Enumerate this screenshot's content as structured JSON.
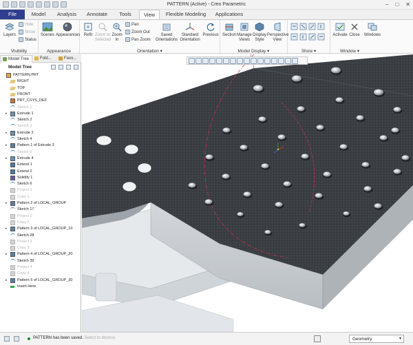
{
  "window": {
    "title": "PATTERN (Active) - Creo Parametric"
  },
  "tabs": [
    "File",
    "Model",
    "Analysis",
    "Annotate",
    "Tools",
    "View",
    "Flexible Modeling",
    "Applications"
  ],
  "ribbon": {
    "visibility": {
      "layers": "Layers",
      "hide": "Hide",
      "show": "Show",
      "status": "Status",
      "label": "Visibility"
    },
    "appearance": {
      "scenes": "Scenes",
      "appearances": "Appearances",
      "label": "Appearance"
    },
    "orientation": {
      "refit": "Refit",
      "zoom_selected_1": "Zoom to",
      "zoom_selected_2": "Selected",
      "zoom_in_1": "Zoom",
      "zoom_in_2": "In",
      "pan": "Pan",
      "zoom_out": "Zoom Out",
      "pan_zoom": "Pan Zoom",
      "saved_1": "Saved",
      "saved_2": "Orientations",
      "standard_1": "Standard",
      "standard_2": "Orientation",
      "previous": "Previous",
      "label": "Orientation"
    },
    "model_display": {
      "section": "Section",
      "manage_views_1": "Manage",
      "manage_views_2": "Views",
      "display_style_1": "Display",
      "display_style_2": "Style",
      "perspective_1": "Perspective",
      "perspective_2": "View",
      "label": "Model Display"
    },
    "show": {
      "label": "Show"
    },
    "window": {
      "activate": "Activate",
      "close": "Close",
      "windows": "Windows",
      "label": "Window"
    }
  },
  "panel": {
    "tabs": [
      "Model Tree",
      "Fold...",
      "Favo..."
    ],
    "tree_label": "Model Tree"
  },
  "tree": [
    {
      "label": "PATTERN.PRT",
      "dim": false,
      "expander": "",
      "icon": "part"
    },
    {
      "label": "RIGHT",
      "dim": false,
      "expander": "",
      "icon": "plane"
    },
    {
      "label": "TOP",
      "dim": false,
      "expander": "",
      "icon": "plane"
    },
    {
      "label": "FRONT",
      "dim": false,
      "expander": "",
      "icon": "plane"
    },
    {
      "label": "PRT_CSYS_DEF",
      "dim": false,
      "expander": "",
      "icon": "csys"
    },
    {
      "label": "Sketch 1",
      "dim": true,
      "expander": "",
      "icon": "sketch"
    },
    {
      "label": "Extrude 1",
      "dim": false,
      "expander": "▸",
      "icon": "extrude"
    },
    {
      "label": "Sketch 2",
      "dim": false,
      "expander": "",
      "icon": "sketch"
    },
    {
      "label": "Sketch 3",
      "dim": true,
      "expander": "",
      "icon": "sketch"
    },
    {
      "label": "Extrude 2",
      "dim": false,
      "expander": "▸",
      "icon": "extrude"
    },
    {
      "label": "Sketch 4",
      "dim": false,
      "expander": "",
      "icon": "sketch"
    },
    {
      "label": "Pattern 1 of Extrude 3",
      "dim": false,
      "expander": "▸",
      "icon": "pattern"
    },
    {
      "label": "Sketch 5",
      "dim": true,
      "expander": "",
      "icon": "sketch"
    },
    {
      "label": "Extrude 4",
      "dim": false,
      "expander": "▸",
      "icon": "extrude"
    },
    {
      "label": "Extend 1",
      "dim": false,
      "expander": "",
      "icon": "extend"
    },
    {
      "label": "Extend 2",
      "dim": false,
      "expander": "",
      "icon": "extend"
    },
    {
      "label": "Solidify 1",
      "dim": false,
      "expander": "",
      "icon": "solidify"
    },
    {
      "label": "Sketch 6",
      "dim": false,
      "expander": "",
      "icon": "sketch"
    },
    {
      "label": "Project 1",
      "dim": true,
      "expander": "",
      "icon": "project"
    },
    {
      "label": "Copy 1",
      "dim": true,
      "expander": "",
      "icon": "copy"
    },
    {
      "label": "Pattern 2 of LOCAL_GROUP",
      "dim": false,
      "expander": "▸",
      "icon": "pattern"
    },
    {
      "label": "Sketch 17",
      "dim": false,
      "expander": "",
      "icon": "sketch"
    },
    {
      "label": "Project 2",
      "dim": true,
      "expander": "",
      "icon": "project"
    },
    {
      "label": "Copy 2",
      "dim": true,
      "expander": "",
      "icon": "copy"
    },
    {
      "label": "Pattern 3 of LOCAL_GROUP_10",
      "dim": false,
      "expander": "▸",
      "icon": "pattern"
    },
    {
      "label": "Sketch 28",
      "dim": false,
      "expander": "",
      "icon": "sketch"
    },
    {
      "label": "Project 3",
      "dim": true,
      "expander": "",
      "icon": "project"
    },
    {
      "label": "Copy 3",
      "dim": true,
      "expander": "",
      "icon": "copy"
    },
    {
      "label": "Pattern 4 of LOCAL_GROUP_20",
      "dim": false,
      "expander": "▸",
      "icon": "pattern"
    },
    {
      "label": "Sketch 39",
      "dim": false,
      "expander": "",
      "icon": "sketch"
    },
    {
      "label": "Project 4",
      "dim": true,
      "expander": "",
      "icon": "project"
    },
    {
      "label": "Copy 4",
      "dim": true,
      "expander": "",
      "icon": "copy"
    },
    {
      "label": "Pattern 5 of LOCAL_GROUP_30",
      "dim": false,
      "expander": "▸",
      "icon": "pattern"
    },
    {
      "label": "Insert Here",
      "dim": false,
      "expander": "",
      "icon": "insert"
    }
  ],
  "status": {
    "message": "PATTERN has been saved.",
    "faded_suffix": "Select to dismiss",
    "selection_filter": "Geometry"
  },
  "colors": {
    "file_tab": "#2f3e8f",
    "plate_top": "#3a3d42",
    "plate_side": "#c9ced3",
    "curve": "#d0314c"
  }
}
